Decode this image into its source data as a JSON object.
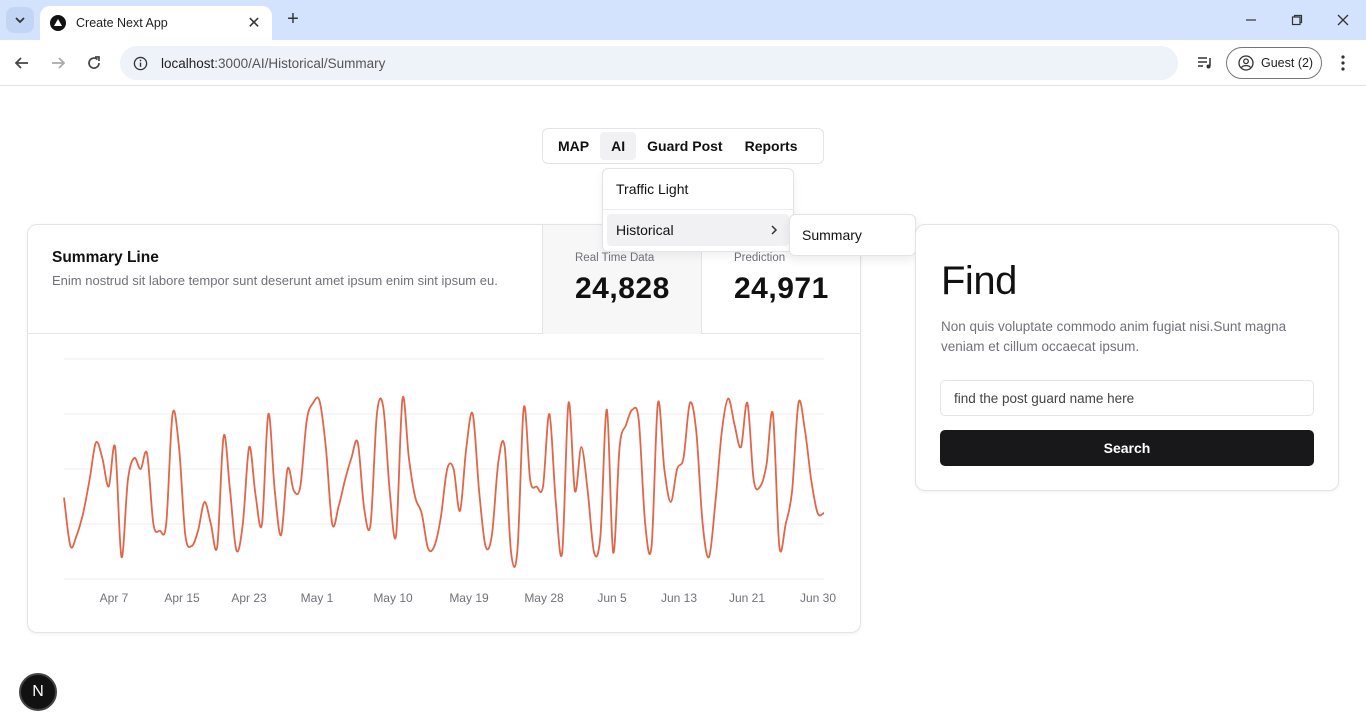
{
  "browser": {
    "tab_title": "Create Next App",
    "url_host": "localhost",
    "url_rest": ":3000/AI/Historical/Summary",
    "profile_label": "Guest (2)"
  },
  "nav": {
    "items": [
      {
        "label": "MAP",
        "active": false
      },
      {
        "label": "AI",
        "active": true
      },
      {
        "label": "Guard Post",
        "active": false
      },
      {
        "label": "Reports",
        "active": false
      }
    ],
    "dropdown": {
      "items": [
        "Traffic Light",
        "Historical"
      ],
      "submenu": [
        "Summary"
      ]
    }
  },
  "summary_card": {
    "title": "Summary Line",
    "description": "Enim nostrud sit labore tempor sunt deserunt amet ipsum enim sint ipsum eu.",
    "stats": [
      {
        "label": "Real Time Data",
        "value": "24,828"
      },
      {
        "label": "Prediction",
        "value": "24,971"
      }
    ]
  },
  "chart_data": {
    "type": "line",
    "color": "#e0664a",
    "grid": true,
    "x_ticks": [
      "Apr 7",
      "Apr 15",
      "Apr 23",
      "May 1",
      "May 10",
      "May 19",
      "May 28",
      "Jun 5",
      "Jun 13",
      "Jun 21",
      "Jun 30"
    ],
    "x_range": [
      "2024-04-01",
      "2024-06-30"
    ],
    "ylim": [
      0,
      100
    ],
    "series": [
      {
        "values": [
          37,
          15,
          20,
          30,
          45,
          62,
          55,
          42,
          60,
          10,
          45,
          55,
          50,
          57,
          25,
          22,
          25,
          75,
          60,
          20,
          15,
          22,
          35,
          25,
          15,
          65,
          40,
          13,
          25,
          60,
          38,
          25,
          75,
          40,
          20,
          50,
          40,
          42,
          72,
          80,
          81,
          60,
          25,
          33,
          45,
          55,
          62,
          32,
          25,
          75,
          78,
          40,
          20,
          82,
          55,
          37,
          30,
          14,
          15,
          28,
          50,
          50,
          31,
          60,
          75,
          40,
          15,
          20,
          53,
          60,
          12,
          13,
          78,
          45,
          42,
          42,
          75,
          35,
          12,
          80,
          40,
          60,
          40,
          12,
          20,
          77,
          12,
          60,
          70,
          77,
          72,
          25,
          15,
          80,
          50,
          35,
          50,
          55,
          80,
          67,
          25,
          10,
          35,
          67,
          82,
          70,
          60,
          80,
          45,
          42,
          52,
          75,
          15,
          25,
          40,
          80,
          68,
          45,
          30,
          30
        ],
        "y_estimate_note": ""
      }
    ]
  }
}
